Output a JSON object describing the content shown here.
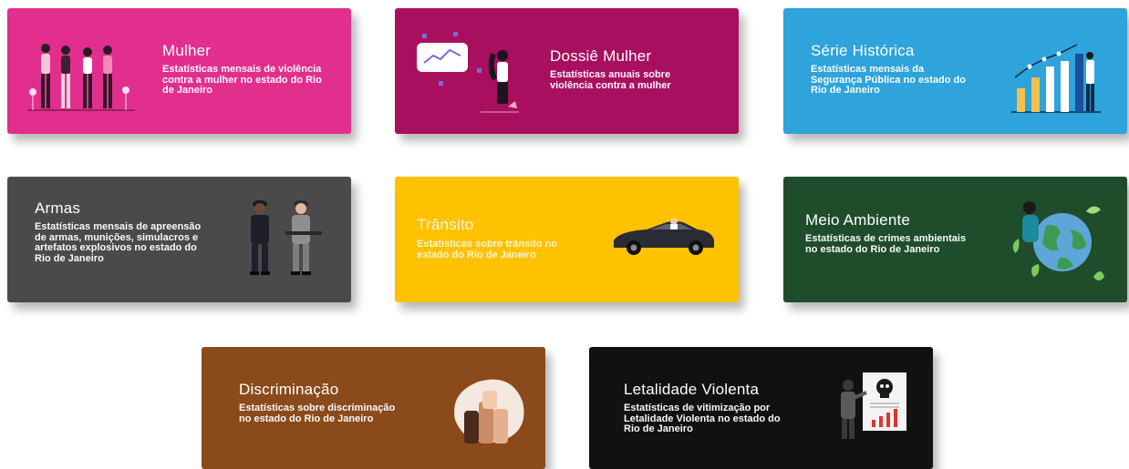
{
  "cards": [
    {
      "title": "Mulher",
      "description": "Estatísticas mensais de violência contra a mulher no estado do Rio de Janeiro",
      "color": "#e22f8e",
      "icon": "women-group-illustration"
    },
    {
      "title": "Dossiê Mulher",
      "description": "Estatísticas anuais sobre violência contra a mulher",
      "color": "#a8105e",
      "icon": "woman-chart-board-illustration"
    },
    {
      "title": "Série Histórica",
      "description": "Estatísticas mensais da Segurança Pública no estado do Rio de Janeiro",
      "color": "#2ea3dc",
      "icon": "bar-chart-person-illustration"
    },
    {
      "title": "Armas",
      "description": "Estatísticas mensais de apreensão de armas, munições, simulacros e artefatos explosivos no estado do Rio de Janeiro",
      "color": "#4a4a4a",
      "icon": "police-officers-illustration"
    },
    {
      "title": "Trânsito",
      "description": "Estatísticas sobre trânsito no estado do Rio de Janeiro",
      "color": "#ffc200",
      "icon": "sports-car-illustration"
    },
    {
      "title": "Meio Ambiente",
      "description": "Estatísticas de crimes ambientais no estado do Rio de Janeiro",
      "color": "#1f4d2c",
      "icon": "earth-plants-illustration"
    },
    {
      "title": "Discriminação",
      "description": "Estatísticas sobre discriminação no estado do Rio de Janeiro",
      "color": "#8b4a1b",
      "icon": "raised-fists-illustration"
    },
    {
      "title": "Letalidade Violenta",
      "description": "Estatísticas de vitimização por Letalidade Violenta no estado do Rio de Janeiro",
      "color": "#111111",
      "icon": "skull-report-illustration"
    }
  ]
}
